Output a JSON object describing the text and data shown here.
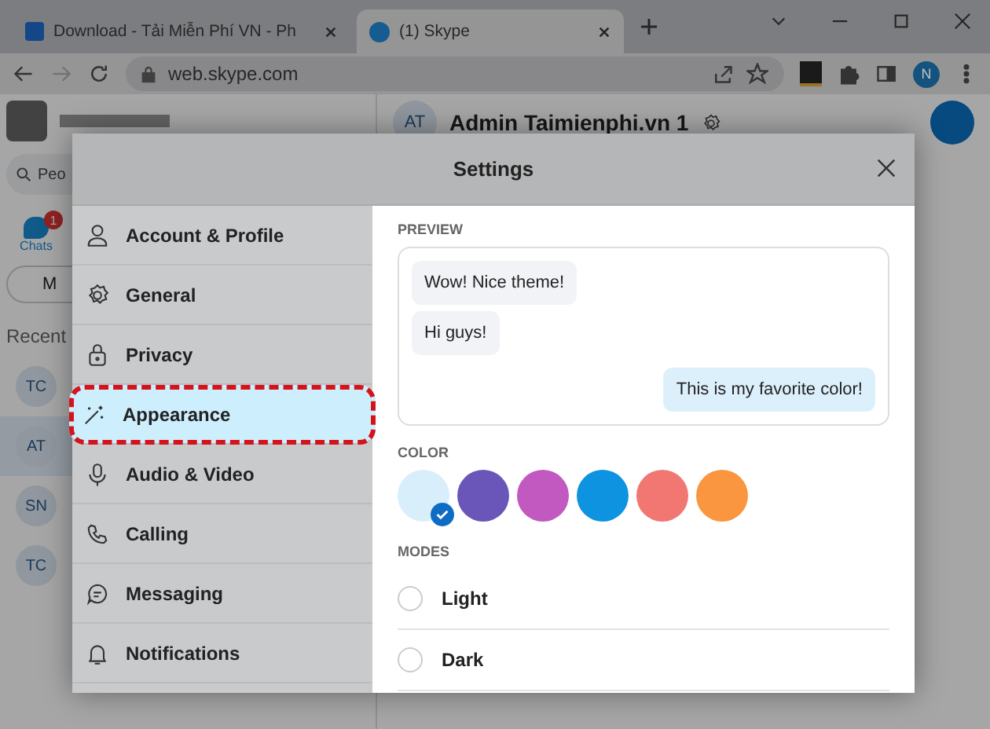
{
  "browser": {
    "tabs": [
      {
        "title": "Download - Tải Miễn Phí VN - Ph",
        "selected": false
      },
      {
        "title": "(1) Skype",
        "selected": true
      }
    ],
    "url": "web.skype.com",
    "profile_initial": "N"
  },
  "skype": {
    "search": {
      "placeholder": "Peo"
    },
    "chats": {
      "label": "Chats",
      "badge": "1"
    },
    "meet_button": "M",
    "recent_label": "Recent",
    "contacts": [
      {
        "initials": "TC",
        "selected": false
      },
      {
        "initials": "AT",
        "selected": true
      },
      {
        "initials": "SN",
        "selected": false
      },
      {
        "initials": "TC",
        "selected": false
      }
    ],
    "header": {
      "initials": "AT",
      "name": "Admin Taimienphi.vn 1"
    }
  },
  "settings": {
    "title": "Settings",
    "menu": [
      {
        "label": "Account & Profile",
        "selected": false
      },
      {
        "label": "General",
        "selected": false
      },
      {
        "label": "Privacy",
        "selected": false
      },
      {
        "label": "Appearance",
        "selected": true
      },
      {
        "label": "Audio & Video",
        "selected": false
      },
      {
        "label": "Calling",
        "selected": false
      },
      {
        "label": "Messaging",
        "selected": false
      },
      {
        "label": "Notifications",
        "selected": false
      }
    ],
    "preview_label": "PREVIEW",
    "messages": [
      {
        "text": "Wow! Nice theme!",
        "outgoing": false
      },
      {
        "text": "Hi guys!",
        "outgoing": false
      },
      {
        "text": "This is my favorite color!",
        "outgoing": true
      }
    ],
    "color_label": "COLOR",
    "colors": [
      {
        "color": "#d9eefb",
        "selected": true
      },
      {
        "color": "#6a55b8",
        "selected": false
      },
      {
        "color": "#c159c0",
        "selected": false
      },
      {
        "color": "#0e93e0",
        "selected": false
      },
      {
        "color": "#f27672",
        "selected": false
      },
      {
        "color": "#f9963f",
        "selected": false
      }
    ],
    "modes_label": "MODES",
    "modes": [
      {
        "label": "Light",
        "selected": false
      },
      {
        "label": "Dark",
        "selected": false
      }
    ]
  }
}
